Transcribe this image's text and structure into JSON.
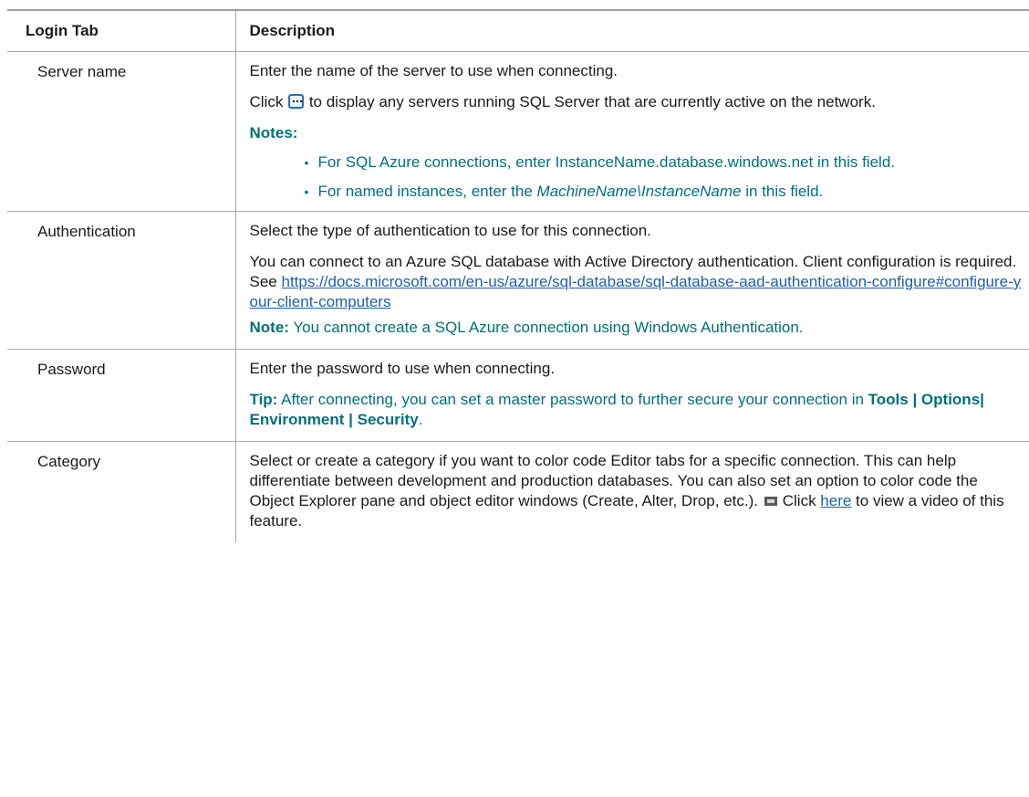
{
  "table": {
    "headers": [
      "Login Tab",
      "Description"
    ],
    "rows": [
      {
        "label": "Server name",
        "desc1": "Enter the name of the server to use when connecting.",
        "click_prefix": "Click",
        "click_suffix": "to display any servers running SQL Server that are currently active on the network.",
        "notes_label": "Notes:",
        "note1": "For SQL Azure connections, enter InstanceName.database.windows.net in this field.",
        "note2_prefix": "For named instances, enter the ",
        "note2_italic": "MachineName\\InstanceName",
        "note2_suffix": " in this field."
      },
      {
        "label": "Authentication",
        "desc1": "Select the type of authentication to use for this connection.",
        "desc2_prefix": "You can connect to an Azure SQL database with Active Directory authentication. Client configuration is required. See ",
        "desc2_link": "https://docs.microsoft.com/en-us/azure/sql-database/sql-database-aad-authentication-configure#configure-your-client-computers",
        "note_bold": "Note:",
        "note_text": " You cannot create a SQL Azure connection using Windows Authentication."
      },
      {
        "label": "Password",
        "desc1": "Enter the password to use when connecting.",
        "tip_bold": "Tip:",
        "tip_text": " After connecting, you can set a master password to further secure your connection in ",
        "tip_path": "Tools | Options| Environment | Security",
        "tip_end": "."
      },
      {
        "label": "Category",
        "desc1": "Select or create a category if you want to color code Editor tabs for a specific connection. This can help differentiate between development and production databases. You can also set an option to color code the Object Explorer pane and object editor windows (Create, Alter, Drop, etc.).",
        "video_prefix": "Click ",
        "video_link": "here",
        "video_suffix": " to view a video of this feature."
      }
    ]
  }
}
